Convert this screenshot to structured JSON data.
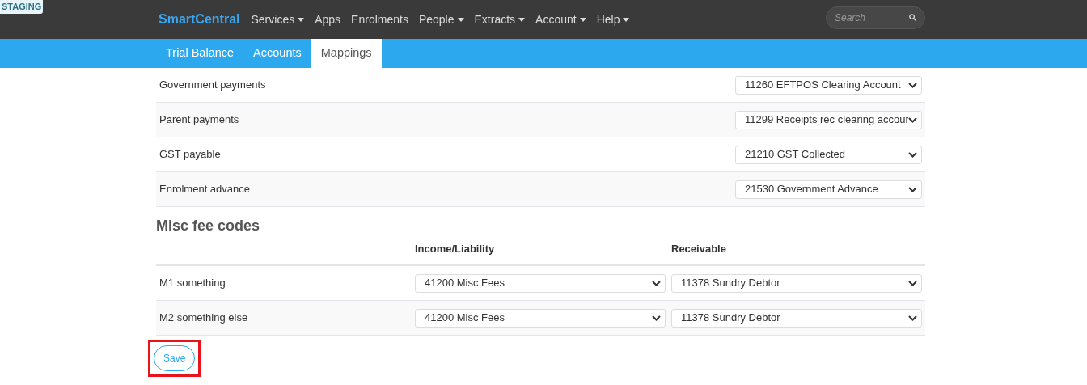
{
  "badge": "STAGING",
  "brand": "SmartCentral",
  "nav": [
    {
      "label": "Services",
      "dropdown": true
    },
    {
      "label": "Apps",
      "dropdown": false
    },
    {
      "label": "Enrolments",
      "dropdown": false
    },
    {
      "label": "People",
      "dropdown": true
    },
    {
      "label": "Extracts",
      "dropdown": true
    },
    {
      "label": "Account",
      "dropdown": true
    },
    {
      "label": "Help",
      "dropdown": true
    }
  ],
  "search": {
    "placeholder": "Search"
  },
  "tabs": [
    {
      "label": "Trial Balance",
      "selected": false
    },
    {
      "label": "Accounts",
      "selected": false
    },
    {
      "label": "Mappings",
      "selected": true
    }
  ],
  "mappings": [
    {
      "label": "Government payments",
      "value": "11260 EFTPOS Clearing Account"
    },
    {
      "label": "Parent payments",
      "value": "11299 Receipts rec clearing accour"
    },
    {
      "label": "GST payable",
      "value": "21210 GST Collected"
    },
    {
      "label": "Enrolment advance",
      "value": "21530 Government Advance"
    }
  ],
  "misc": {
    "title": "Misc fee codes",
    "columns": [
      "Income/Liability",
      "Receivable"
    ],
    "rows": [
      {
        "label": "M1 something",
        "income": "41200 Misc Fees",
        "receivable": "11378 Sundry Debtor"
      },
      {
        "label": "M2 something else",
        "income": "41200 Misc Fees",
        "receivable": "11378 Sundry Debtor"
      }
    ]
  },
  "save_button": {
    "label": "Save",
    "highlighted": true
  }
}
